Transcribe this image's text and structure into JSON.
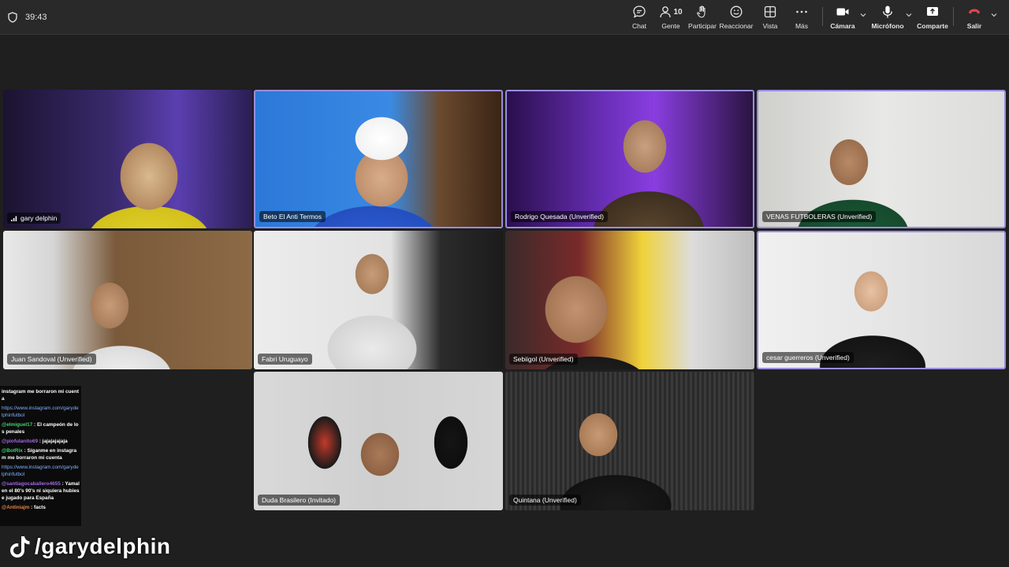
{
  "topbar": {
    "timer": "39:43",
    "buttons": [
      {
        "label": "Chat",
        "icon": "chat-icon"
      },
      {
        "label": "Gente",
        "icon": "people-icon",
        "count": "10"
      },
      {
        "label": "Participar",
        "icon": "raise-hand-icon"
      },
      {
        "label": "Reaccionar",
        "icon": "smile-icon"
      },
      {
        "label": "Vista",
        "icon": "grid-view-icon"
      },
      {
        "label": "Más",
        "icon": "more-icon"
      },
      {
        "label": "Cámara",
        "icon": "camera-icon"
      },
      {
        "label": "Micrófono",
        "icon": "microphone-icon"
      },
      {
        "label": "Comparte",
        "icon": "share-icon"
      },
      {
        "label": "Salir",
        "icon": "hang-up-icon"
      }
    ]
  },
  "participants": [
    {
      "name": "gary delphin",
      "signal": true
    },
    {
      "name": "Beto El Anti Termos"
    },
    {
      "name": "Rodrigo Quesada (Unverified)"
    },
    {
      "name": "VENAS FUTBOLERAS (Unverified)"
    },
    {
      "name": "Juan Sandoval (Unverified)"
    },
    {
      "name": "Fabri Uruguayo"
    },
    {
      "name": "Sebiigol (Unverified)"
    },
    {
      "name": "cesar guerreros (Unverified)"
    },
    {
      "name": "Duda Brasilero (Invitado)"
    },
    {
      "name": "Quintana (Unverified)"
    }
  ],
  "chat": [
    {
      "user": "",
      "text": "instagram me borraron mi cuenta",
      "color": "#ffffff"
    },
    {
      "user": "",
      "text": "https://www.instagram.com/garydelphinfutbol",
      "color": "#7fb0ff",
      "link": true
    },
    {
      "user": "@elmiguel17",
      "text": ": El campeón de los penales",
      "color": "#3fd46a"
    },
    {
      "user": "@piofulanito69",
      "text": ": jajajajajaja",
      "color": "#a565e8"
    },
    {
      "user": "@BotRix",
      "text": ": Síganme en instagram me borraron mi cuenta",
      "color": "#3fd46a"
    },
    {
      "user": "",
      "text": "https://www.instagram.com/garydelphinfutbol",
      "color": "#7fb0ff",
      "link": true
    },
    {
      "user": "@santiagocaballero4655",
      "text": ": Yamal en el 80's 90's ni siquiera hubiese jugado para España",
      "color": "#a565e8"
    },
    {
      "user": "@Antiniajm",
      "text": ": facts",
      "color": "#e8823f"
    }
  ],
  "watermark": {
    "handle": "/garydelphin",
    "icon": "tiktok-icon"
  },
  "colors": {
    "topbar": "#292929",
    "background": "#1f1f1f",
    "active_border": "#9a8ce0",
    "hangup": "#e0474c"
  }
}
